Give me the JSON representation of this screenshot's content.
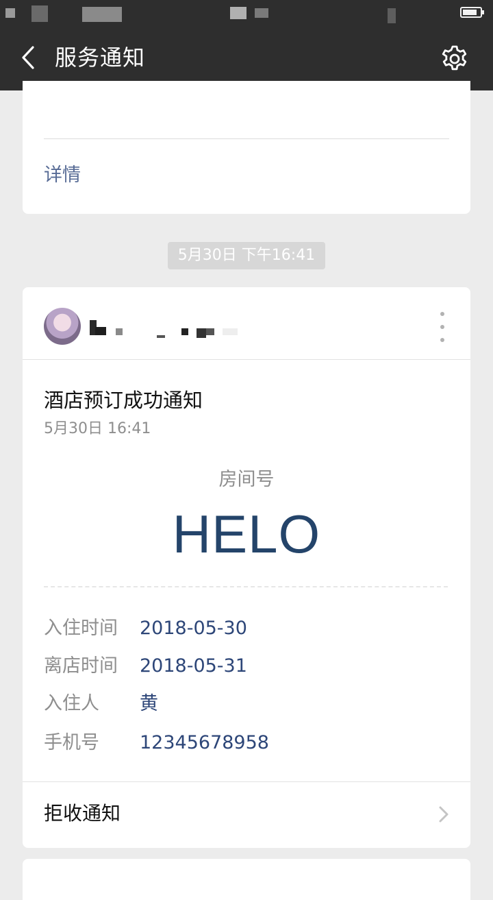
{
  "header": {
    "title": "服务通知",
    "back_icon": "chevron-left-icon",
    "settings_icon": "gear-icon"
  },
  "previous_card": {
    "detail_link": "详情"
  },
  "timestamp_divider": "5月30日 下午16:41",
  "notification": {
    "title": "酒店预订成功通知",
    "date": "5月30日  16:41",
    "room_label": "房间号",
    "room_value": "HELO",
    "fields": [
      {
        "key": "入住时间",
        "value": "2018-05-30"
      },
      {
        "key": "离店时间",
        "value": "2018-05-31"
      },
      {
        "key": "入住人",
        "value": "黄"
      },
      {
        "key": "手机号",
        "value": "12345678958"
      }
    ],
    "reject_label": "拒收通知"
  },
  "colors": {
    "bar": "#2e2e2e",
    "background": "#ececec",
    "link": "#576b95",
    "room_value": "#24446a",
    "field_value": "#2d4678"
  }
}
